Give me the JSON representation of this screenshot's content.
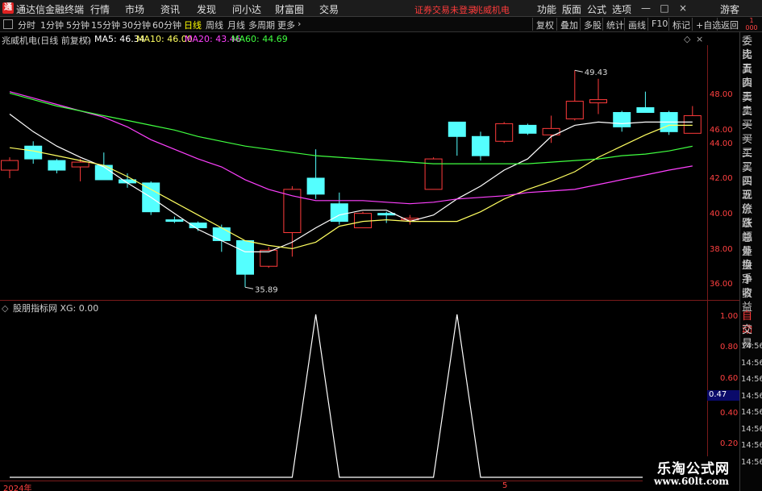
{
  "window": {
    "app_name": "通达信金融终端",
    "logo_glyph": "通",
    "menus": [
      "行情",
      "市场",
      "资讯",
      "发现",
      "问小达",
      "财富圈",
      "交易"
    ],
    "notice": "证券交易未登录",
    "stock": "兆威机电",
    "right_menus": [
      "功能",
      "版面",
      "公式",
      "选项"
    ],
    "guest": "游客",
    "win_buttons": [
      "—",
      "□",
      "×"
    ]
  },
  "toolbar": {
    "timeframes": [
      "分时",
      "1分钟",
      "5分钟",
      "15分钟",
      "30分钟",
      "60分钟",
      "日线",
      "周线",
      "月线",
      "多周期",
      "更多"
    ],
    "active": "日线",
    "more_arrow": "›",
    "right_buttons": [
      "复权",
      "叠加",
      "多股",
      "统计",
      "画线",
      "F10",
      "标记",
      "+自选",
      "返回"
    ],
    "right_number_top": "1",
    "right_number_bottom": "000"
  },
  "main_chart": {
    "header": {
      "stock_label": "兆威机电(日线 前复权)",
      "ma5": "MA5: 46.34",
      "ma10": "MA10: 46.00",
      "ma20": "MA20: 43.46",
      "ma60": "MA60: 44.69",
      "settings_icon": "◇",
      "close_icon": "×"
    },
    "colors": {
      "up": "#ff3b3b",
      "down": "#54ffff",
      "ma5": "#ffffff",
      "ma10": "#ffff60",
      "ma20": "#ff40ff",
      "ma60": "#40ff40",
      "axis": "#ff4040"
    },
    "price_ticks": [
      "48.00",
      "46.00",
      "44.00",
      "42.00",
      "40.00",
      "38.00",
      "36.00"
    ],
    "high_label": "49.43",
    "low_label": "35.89"
  },
  "chart_data": {
    "type": "candlestick",
    "ylim": [
      35.3,
      50.8
    ],
    "candles": [
      {
        "o": 43.2,
        "c": 43.8,
        "h": 44.0,
        "l": 42.7
      },
      {
        "o": 44.7,
        "c": 43.9,
        "h": 45.0,
        "l": 43.6
      },
      {
        "o": 43.8,
        "c": 43.2,
        "h": 43.9,
        "l": 43.0
      },
      {
        "o": 43.4,
        "c": 43.7,
        "h": 43.9,
        "l": 42.5
      },
      {
        "o": 43.5,
        "c": 42.6,
        "h": 44.3,
        "l": 42.6
      },
      {
        "o": 42.6,
        "c": 42.4,
        "h": 43.0,
        "l": 42.1
      },
      {
        "o": 42.4,
        "c": 40.6,
        "h": 42.5,
        "l": 40.4
      },
      {
        "o": 40.1,
        "c": 40.0,
        "h": 40.3,
        "l": 39.9
      },
      {
        "o": 39.9,
        "c": 39.6,
        "h": 40.0,
        "l": 39.4
      },
      {
        "o": 39.6,
        "c": 38.8,
        "h": 39.8,
        "l": 38.1
      },
      {
        "o": 38.8,
        "c": 36.7,
        "h": 38.8,
        "l": 35.89
      },
      {
        "o": 37.2,
        "c": 38.2,
        "h": 38.4,
        "l": 37.1
      },
      {
        "o": 39.3,
        "c": 42.0,
        "h": 42.2,
        "l": 37.8
      },
      {
        "o": 42.7,
        "c": 41.7,
        "h": 44.5,
        "l": 41.4
      },
      {
        "o": 41.1,
        "c": 40.0,
        "h": 41.8,
        "l": 39.8
      },
      {
        "o": 39.6,
        "c": 40.5,
        "h": 40.6,
        "l": 39.6
      },
      {
        "o": 40.5,
        "c": 40.4,
        "h": 40.6,
        "l": 39.9
      },
      {
        "o": 40.1,
        "c": 40.2,
        "h": 40.4,
        "l": 39.8
      },
      {
        "o": 42.0,
        "c": 43.9,
        "h": 44.0,
        "l": 42.0
      },
      {
        "o": 46.2,
        "c": 45.3,
        "h": 46.2,
        "l": 44.1
      },
      {
        "o": 45.3,
        "c": 44.1,
        "h": 45.6,
        "l": 43.8
      },
      {
        "o": 45.0,
        "c": 46.1,
        "h": 46.2,
        "l": 44.9
      },
      {
        "o": 46.0,
        "c": 45.5,
        "h": 46.1,
        "l": 45.4
      },
      {
        "o": 45.4,
        "c": 45.8,
        "h": 46.6,
        "l": 44.9
      },
      {
        "o": 46.4,
        "c": 47.5,
        "h": 49.43,
        "l": 46.3
      },
      {
        "o": 47.4,
        "c": 47.6,
        "h": 48.9,
        "l": 46.7
      },
      {
        "o": 46.8,
        "c": 45.9,
        "h": 46.9,
        "l": 45.6
      },
      {
        "o": 47.1,
        "c": 46.8,
        "h": 48.1,
        "l": 46.8
      },
      {
        "o": 46.8,
        "c": 45.6,
        "h": 46.9,
        "l": 45.4
      },
      {
        "o": 45.5,
        "c": 46.6,
        "h": 47.2,
        "l": 45.5
      }
    ],
    "ma5": [
      46.7,
      45.6,
      44.7,
      44.0,
      43.4,
      42.4,
      41.5,
      40.5,
      39.5,
      38.8,
      38.1,
      38.1,
      38.7,
      39.6,
      40.4,
      40.7,
      40.7,
      40.0,
      40.4,
      41.4,
      42.2,
      43.2,
      43.9,
      45.3,
      46.0,
      46.2,
      46.1,
      46.2,
      46.2,
      46.2
    ],
    "ma10": [
      44.6,
      44.4,
      44.1,
      43.8,
      43.5,
      42.8,
      42.0,
      41.2,
      40.4,
      39.6,
      38.8,
      38.5,
      38.3,
      38.7,
      39.7,
      40.0,
      40.1,
      40.0,
      40.0,
      40.0,
      40.6,
      41.4,
      42.0,
      42.5,
      43.1,
      44.0,
      44.7,
      45.4,
      46.0,
      46.0
    ],
    "ma20": [
      48.1,
      47.7,
      47.3,
      46.9,
      46.5,
      45.9,
      45.1,
      44.5,
      43.9,
      43.4,
      42.6,
      42.0,
      41.6,
      41.3,
      41.3,
      41.3,
      41.2,
      41.1,
      41.2,
      41.4,
      41.5,
      41.6,
      41.8,
      41.9,
      42.0,
      42.3,
      42.6,
      42.9,
      43.2,
      43.46
    ],
    "ma60": [
      48.0,
      47.6,
      47.2,
      46.9,
      46.6,
      46.3,
      46.0,
      45.7,
      45.3,
      45.0,
      44.7,
      44.5,
      44.3,
      44.1,
      44.0,
      43.9,
      43.8,
      43.7,
      43.6,
      43.6,
      43.6,
      43.6,
      43.6,
      43.7,
      43.8,
      43.9,
      44.1,
      44.2,
      44.4,
      44.69
    ]
  },
  "indicator": {
    "header": "股朋指标网 XG: 0.00",
    "ticks": [
      "1.00",
      "0.80",
      "0.60",
      "0.40",
      "0.20"
    ],
    "cursor_value": "0.47",
    "xg_values": [
      0,
      0,
      0,
      0,
      0,
      0,
      0,
      0,
      0,
      0,
      0,
      0,
      0,
      1,
      0,
      0,
      0,
      0,
      0,
      1,
      0,
      0,
      0,
      0,
      0,
      0,
      0,
      0,
      0,
      0
    ],
    "line_color": "#ffffff"
  },
  "right_panel": {
    "items": [
      "委比",
      "卖五",
      "卖四",
      "卖三",
      "卖二",
      "卖一",
      "买一",
      "买二",
      "买三",
      "买四",
      "买五",
      "现价",
      "涨跌",
      "涨幅",
      "总量",
      "外盘",
      "换手",
      "净资",
      "收益"
    ],
    "trade_items": [
      "自动",
      "交易"
    ],
    "times": [
      "14:56",
      "14:56",
      "14:56",
      "14:56",
      "14:56",
      "14:56",
      "14:56",
      "14:56"
    ]
  },
  "bottom": {
    "date_start": "2024年",
    "date_mid": "5"
  },
  "watermark": {
    "line1": "乐淘公式网",
    "line2": "www.60lt.com"
  }
}
